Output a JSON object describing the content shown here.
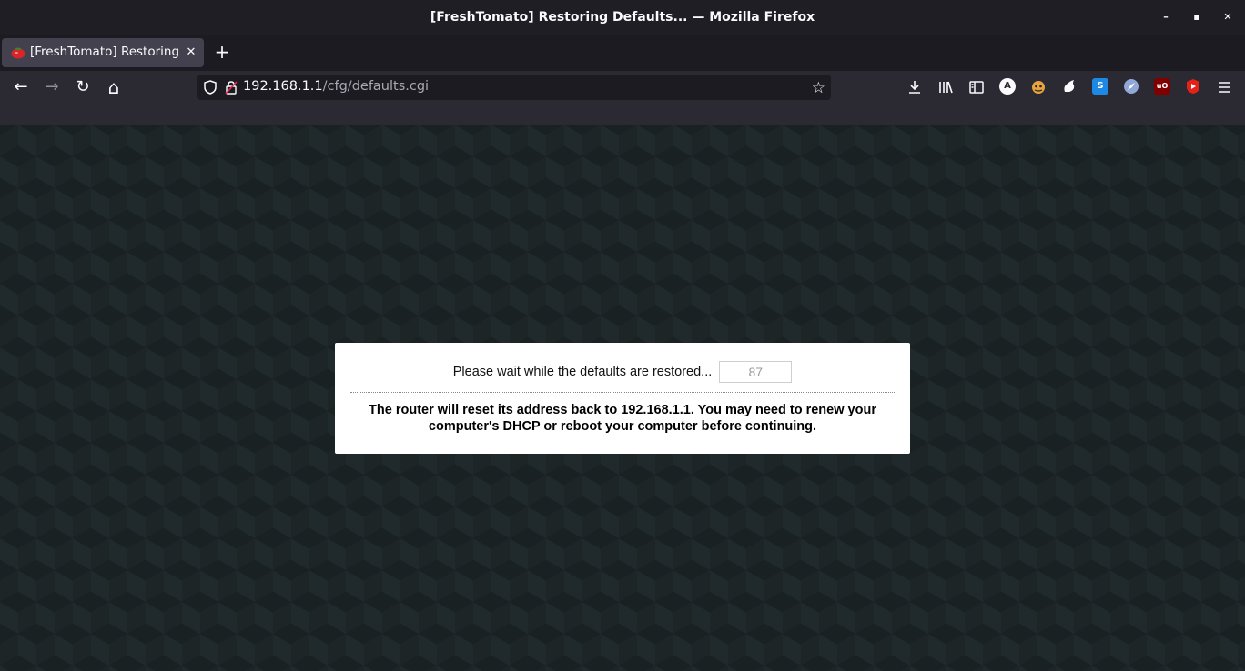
{
  "window": {
    "title": "[FreshTomato] Restoring Defaults... — Mozilla Firefox",
    "minimize_glyph": "–",
    "maximize_glyph": "▪",
    "close_glyph": "✕"
  },
  "tab": {
    "label": "[FreshTomato] Restoring Defaults...",
    "close_glyph": "✕",
    "new_tab_glyph": "+"
  },
  "nav": {
    "back_glyph": "←",
    "forward_glyph": "→",
    "reload_glyph": "↻",
    "home_glyph": "⌂",
    "url_host": "192.168.1.1",
    "url_path": "/cfg/defaults.cgi",
    "star_glyph": "☆"
  },
  "toolbar_icons": [
    "download-icon",
    "library-icon",
    "sidebar-icon",
    "extension-a-icon",
    "extension-face-icon",
    "extension-paw-icon",
    "extension-s-icon",
    "extension-compass-icon",
    "ublock-icon",
    "youtube-icon",
    "menu-icon"
  ],
  "extensions": {
    "a_label": "A",
    "s_label": "S",
    "ublock_label": "uO"
  },
  "dialog": {
    "wait_message": "Please wait while the defaults are restored...",
    "countdown": "87",
    "note": "The router will reset its address back to 192.168.1.1. You may need to renew your computer's DHCP or reboot your computer before continuing."
  },
  "colors": {
    "chrome_dark": "#1c1b22",
    "toolbar": "#2b2a33",
    "tab_active": "#42414d",
    "content_bg": "#1d2527",
    "dialog_bg": "#ffffff"
  }
}
